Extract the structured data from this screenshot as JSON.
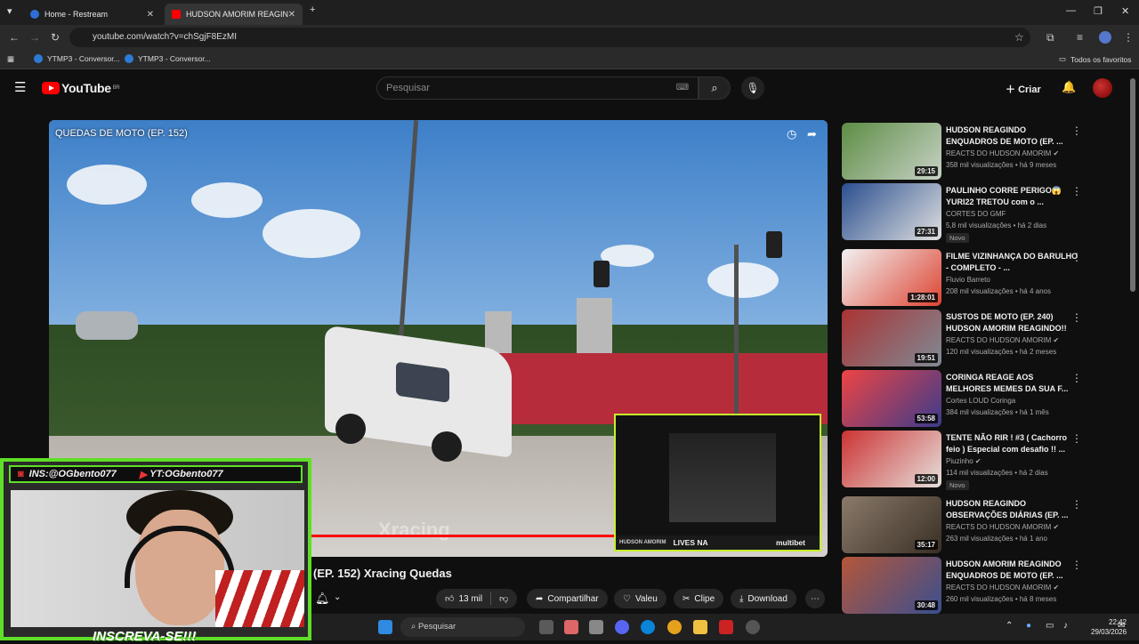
{
  "browser": {
    "tabs": [
      {
        "title": "Home - Restream"
      },
      {
        "title": "HUDSON AMORIM REAGIN"
      }
    ],
    "url": "youtube.com/watch?v=chSgjF8EzMI",
    "bookmarks": [
      {
        "label": "YTMP3 - Conversor..."
      },
      {
        "label": "YTMP3 - Conversor..."
      }
    ],
    "favorites_label": "Todos os favoritos"
  },
  "header": {
    "logo": "YouTube",
    "region": "BR",
    "search_placeholder": "Pesquisar",
    "create_label": "Criar"
  },
  "player": {
    "overlay_title": "QUEDAS DE MOTO (EP. 152)",
    "watermark": "Xracing",
    "inset_label": "LIVES NA",
    "inset_sponsor": "multibet",
    "inset_brand": "HUDSON AMORIM"
  },
  "streamer": {
    "instagram": "INS:@OGbento077",
    "youtube": "YT:OGbento077",
    "subscribe": "INSCREVA-SE!!!"
  },
  "video": {
    "title": "(EP. 152) Xracing Quedas",
    "actions": {
      "likes": "13 mil",
      "share": "Compartilhar",
      "thanks": "Valeu",
      "clip": "Clipe",
      "download": "Download"
    }
  },
  "recommendations": [
    {
      "title": "HUDSON REAGINDO ENQUADROS DE MOTO (EP. ...",
      "channel": "REACTS DO HUDSON AMORIM",
      "verified": true,
      "meta": "358 mil visualizações • há 9 meses",
      "duration": "29:15",
      "badge": "",
      "color": "#4f7d3c"
    },
    {
      "title": "PAULINHO CORRE PERIGO😱 YURI22 TRETOU com o ...",
      "channel": "CORTES DO GMF",
      "verified": false,
      "meta": "5,8 mil visualizações • há 2 dias",
      "duration": "27:31",
      "badge": "Novo",
      "color": "#3c5b8f"
    },
    {
      "title": "FILME VIZINHANÇA DO BARULHO - COMPLETO - ...",
      "channel": "Fluvio Barreto",
      "verified": false,
      "meta": "208 mil visualizações • há 4 anos",
      "duration": "1:28:01",
      "badge": "",
      "color": "#e9e9e9"
    },
    {
      "title": "SUSTOS DE MOTO (EP. 240) HUDSON AMORIM REAGINDO!!",
      "channel": "REACTS DO HUDSON AMORIM",
      "verified": true,
      "meta": "120 mil visualizações • há 2 meses",
      "duration": "19:51",
      "badge": "",
      "color": "#6d7c8e"
    },
    {
      "title": "CORINGA REAGE AOS MELHORES MEMES DA SUA F...",
      "channel": "Cortes LOUD Coringa",
      "verified": false,
      "meta": "384 mil visualizações • há 1 mês",
      "duration": "53:58",
      "badge": "",
      "color": "#5b3b8c"
    },
    {
      "title": "TENTE NÃO RIR ! #3 ( Cachorro feio ) Especial com desafio !! ...",
      "channel": "Piuzinho",
      "verified": true,
      "meta": "114 mil visualizações • há 2 dias",
      "duration": "12:00",
      "badge": "Novo",
      "color": "#d9d3cf"
    },
    {
      "title": "HUDSON REAGINDO OBSERVAÇÕES DIÁRIAS (EP. ...",
      "channel": "REACTS DO HUDSON AMORIM",
      "verified": true,
      "meta": "263 mil visualizações • há 1 ano",
      "duration": "35:17",
      "badge": "",
      "color": "#6a5a4a"
    },
    {
      "title": "HUDSON AMORIM REAGINDO ENQUADROS DE MOTO (EP. ...",
      "channel": "REACTS DO HUDSON AMORIM",
      "verified": true,
      "meta": "260 mil visualizações • há 8 meses",
      "duration": "30:48",
      "badge": "",
      "color": "#8a5a3a"
    }
  ],
  "taskbar": {
    "search": "Pesquisar",
    "time": "22:42",
    "date": "29/03/2026"
  }
}
